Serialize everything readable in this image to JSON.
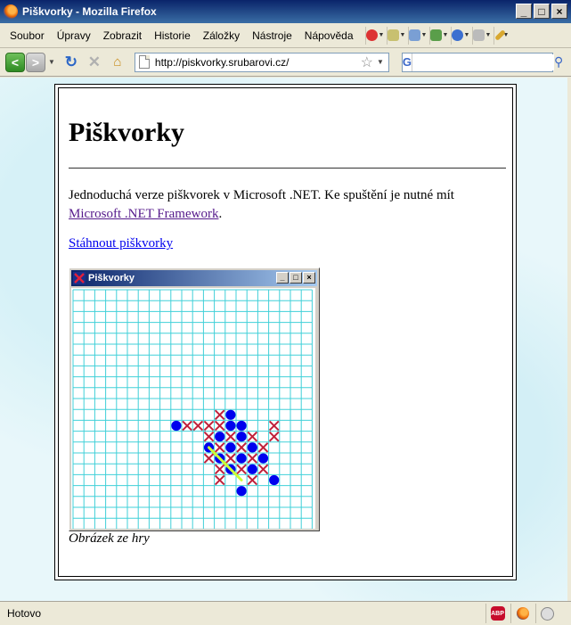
{
  "window": {
    "title": "Piškvorky - Mozilla Firefox",
    "btn_minimize": "_",
    "btn_maximize": "□",
    "btn_close": "×"
  },
  "menu": {
    "items": [
      "Soubor",
      "Úpravy",
      "Zobrazit",
      "Historie",
      "Záložky",
      "Nástroje",
      "Nápověda"
    ],
    "extension_icons": [
      "noscript-icon",
      "clipboard-icon",
      "form-icon",
      "image-icon",
      "info-icon",
      "package-icon",
      "brush-icon"
    ]
  },
  "nav": {
    "url": "http://piskvorky.srubarovi.cz/",
    "search_value": "",
    "search_engine": "G"
  },
  "page": {
    "title": "Piškvorky",
    "intro_text": "Jednoduchá verze piškvorek v Microsoft .NET. Ke spuštění je nutné mít ",
    "intro_link": "Microsoft .NET Framework",
    "intro_end": ".",
    "download_link": "Stáhnout piškvorky",
    "caption": "Obrázek ze hry"
  },
  "game": {
    "title": "Piškvorky",
    "btn_minimize": "_",
    "btn_maximize": "□",
    "btn_close": "×",
    "grid_color": "#40d0d8",
    "cross_color": "#c0203a",
    "circle_color": "#0000ee",
    "win_line_color": "#ccff33",
    "crosses": [
      [
        13,
        11
      ],
      [
        10,
        12
      ],
      [
        11,
        12
      ],
      [
        12,
        12
      ],
      [
        13,
        12
      ],
      [
        18,
        12
      ],
      [
        12,
        13
      ],
      [
        14,
        13
      ],
      [
        16,
        13
      ],
      [
        18,
        13
      ],
      [
        13,
        14
      ],
      [
        15,
        14
      ],
      [
        17,
        14
      ],
      [
        12,
        15
      ],
      [
        14,
        15
      ],
      [
        16,
        15
      ],
      [
        13,
        16
      ],
      [
        15,
        16
      ],
      [
        17,
        16
      ],
      [
        13,
        17
      ],
      [
        16,
        17
      ]
    ],
    "circles": [
      [
        9,
        12
      ],
      [
        14,
        11
      ],
      [
        14,
        12
      ],
      [
        15,
        12
      ],
      [
        13,
        13
      ],
      [
        15,
        13
      ],
      [
        12,
        14
      ],
      [
        14,
        14
      ],
      [
        16,
        14
      ],
      [
        13,
        15
      ],
      [
        15,
        15
      ],
      [
        17,
        15
      ],
      [
        14,
        16
      ],
      [
        18,
        17
      ],
      [
        16,
        16
      ],
      [
        15,
        18
      ]
    ],
    "win_line": {
      "from": [
        12,
        14
      ],
      "to": [
        15,
        17
      ]
    }
  },
  "status": {
    "text": "Hotovo",
    "icons": [
      "adblock-icon",
      "firefox-icon",
      "smiley-icon"
    ],
    "abp_label": "ABP"
  }
}
